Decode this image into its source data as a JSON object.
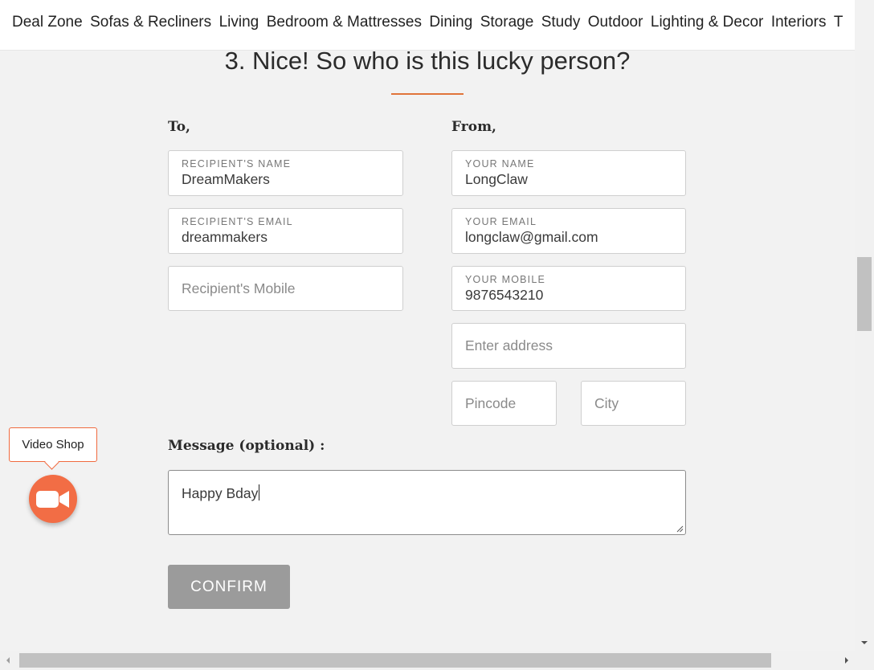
{
  "nav": {
    "items": [
      "Deal Zone",
      "Sofas & Recliners",
      "Living",
      "Bedroom & Mattresses",
      "Dining",
      "Storage",
      "Study",
      "Outdoor",
      "Lighting & Decor",
      "Interiors",
      "T"
    ]
  },
  "step": {
    "heading": "3. Nice! So who is this lucky person?",
    "accent_color": "#e0743a"
  },
  "to": {
    "label": "To,",
    "name": {
      "label": "RECIPIENT'S NAME",
      "value": "DreamMakers"
    },
    "email": {
      "label": "RECIPIENT'S EMAIL",
      "value": "dreammakers"
    },
    "mobile": {
      "placeholder": "Recipient's Mobile"
    }
  },
  "from": {
    "label": "From,",
    "name": {
      "label": "YOUR NAME",
      "value": "LongClaw"
    },
    "email": {
      "label": "YOUR EMAIL",
      "value": "longclaw@gmail.com"
    },
    "mobile": {
      "label": "YOUR MOBILE",
      "value": "9876543210"
    },
    "address": {
      "placeholder": "Enter address"
    },
    "pincode": {
      "placeholder": "Pincode"
    },
    "city": {
      "placeholder": "City"
    }
  },
  "message": {
    "label": "Message (optional) :",
    "value": "Happy Bday"
  },
  "confirm_label": "CONFIRM",
  "video_shop": {
    "label": "Video Shop",
    "icon": "video-camera-icon",
    "color": "#f26d45"
  }
}
